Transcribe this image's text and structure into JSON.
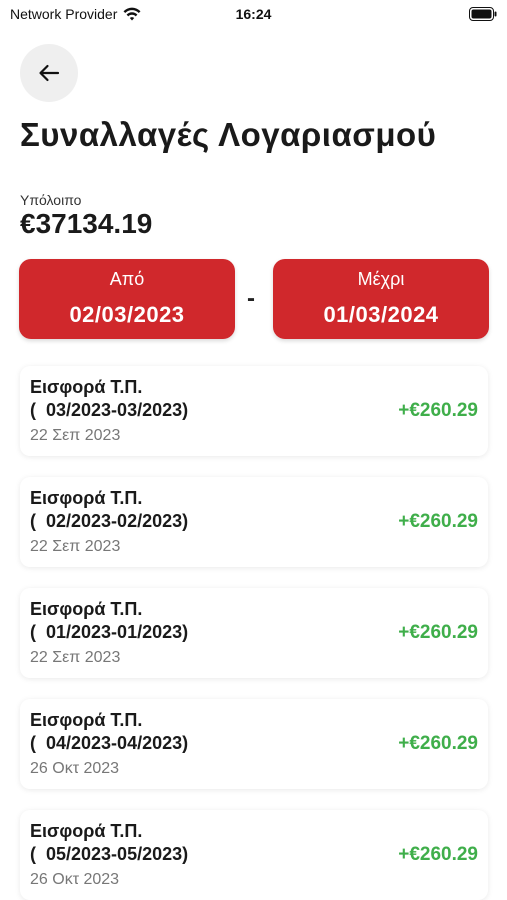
{
  "status_bar": {
    "carrier": "Network Provider",
    "time": "16:24",
    "wifi_icon": "wifi-icon",
    "battery_icon": "battery-icon"
  },
  "header": {
    "back_icon": "arrow-left-icon",
    "title": "Συναλλαγές Λογαριασμού"
  },
  "balance": {
    "label": "Υπόλοιπο",
    "value": "€37134.19"
  },
  "date_range": {
    "from_label": "Από",
    "from_value": "02/03/2023",
    "separator": "-",
    "to_label": "Μέχρι",
    "to_value": "01/03/2024",
    "accent_color": "#d0282c"
  },
  "transactions": [
    {
      "title": "Εισφορά Τ.Π.\n(  03/2023-03/2023)",
      "date": "22 Σεπ 2023",
      "amount": "+€260.29"
    },
    {
      "title": "Εισφορά Τ.Π.\n(  02/2023-02/2023)",
      "date": "22 Σεπ 2023",
      "amount": "+€260.29"
    },
    {
      "title": "Εισφορά Τ.Π.\n(  01/2023-01/2023)",
      "date": "22 Σεπ 2023",
      "amount": "+€260.29"
    },
    {
      "title": "Εισφορά Τ.Π.\n(  04/2023-04/2023)",
      "date": "26 Οκτ 2023",
      "amount": "+€260.29"
    },
    {
      "title": "Εισφορά Τ.Π.\n(  05/2023-05/2023)",
      "date": "26 Οκτ 2023",
      "amount": "+€260.29"
    }
  ],
  "colors": {
    "positive_amount": "#3fae4a"
  }
}
